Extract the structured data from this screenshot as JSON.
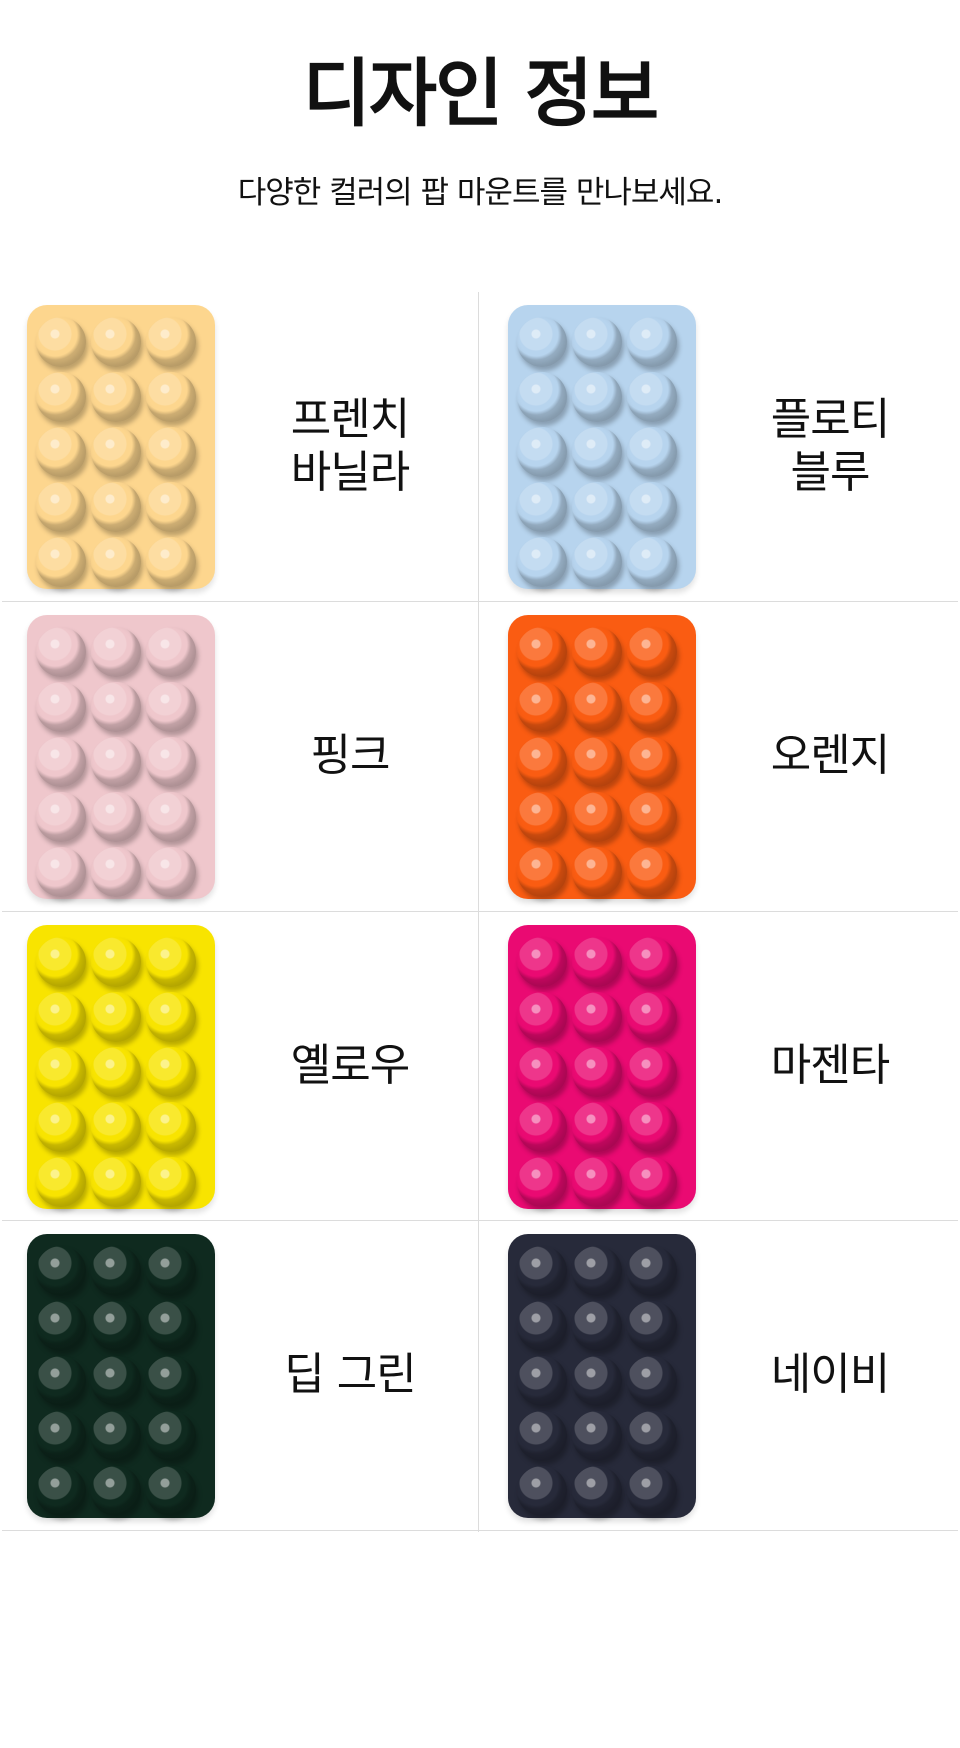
{
  "header": {
    "title": "디자인 정보",
    "subtitle": "다양한 컬러의 팝 마운트를 만나보세요."
  },
  "colors": [
    {
      "name_line1": "프렌치",
      "name_line2": "바닐라",
      "swatch": "#fdd68e"
    },
    {
      "name_line1": "플로티",
      "name_line2": "블루",
      "swatch": "#b7d4ee"
    },
    {
      "name_line1": "핑크",
      "name_line2": "",
      "swatch": "#efc7cc"
    },
    {
      "name_line1": "오렌지",
      "name_line2": "",
      "swatch": "#fa5c12"
    },
    {
      "name_line1": "옐로우",
      "name_line2": "",
      "swatch": "#f8e400"
    },
    {
      "name_line1": "마젠타",
      "name_line2": "",
      "swatch": "#ea0a72"
    },
    {
      "name_line1": "딥 그린",
      "name_line2": "",
      "swatch": "#0f2a1f"
    },
    {
      "name_line1": "네이비",
      "name_line2": "",
      "swatch": "#272a3a"
    }
  ]
}
